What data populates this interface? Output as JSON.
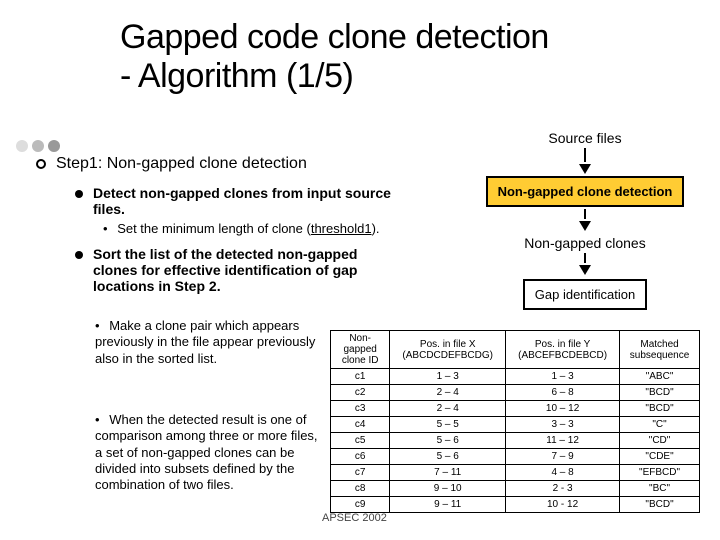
{
  "title_line1": "Gapped code clone detection",
  "title_line2": " - Algorithm (1/5)",
  "step1": "Step1: Non-gapped clone detection",
  "bullet1": "Detect non-gapped clones from input source files.",
  "bullet1_sub_prefix": "Set the minimum length of clone (",
  "bullet1_sub_underline": "threshold1",
  "bullet1_sub_suffix": ").",
  "bullet2": "Sort the list of the detected non-gapped clones for effective identification of gap locations in Step 2.",
  "note1": "Make a clone pair which appears previously in the file appear previously also in the sorted list.",
  "note2": "When the detected result is one of comparison among three or more files, a set of non-gapped clones can be divided into subsets defined by the combination of two files.",
  "flow": {
    "source_files": "Source files",
    "box1": "Non-gapped clone detection",
    "nongapped_clones": "Non-gapped clones",
    "box2": "Gap identification"
  },
  "table": {
    "headers": [
      "Non-gapped clone ID",
      "Pos. in file X (ABCDCDEFBCDG)",
      "Pos. in file Y (ABCEFBCDEBCD)",
      "Matched subsequence"
    ],
    "rows": [
      [
        "c1",
        "1 – 3",
        "1 – 3",
        "\"ABC\""
      ],
      [
        "c2",
        "2 – 4",
        "6 – 8",
        "\"BCD\""
      ],
      [
        "c3",
        "2 – 4",
        "10 – 12",
        "\"BCD\""
      ],
      [
        "c4",
        "5 – 5",
        "3 – 3",
        "\"C\""
      ],
      [
        "c5",
        "5 – 6",
        "11 – 12",
        "\"CD\""
      ],
      [
        "c6",
        "5 – 6",
        "7 – 9",
        "\"CDE\""
      ],
      [
        "c7",
        "7 – 11",
        "4 – 8",
        "\"EFBCD\""
      ],
      [
        "c8",
        "9 – 10",
        "2 - 3",
        "\"BC\""
      ],
      [
        "c9",
        "9 – 11",
        "10 - 12",
        "\"BCD\""
      ]
    ]
  },
  "footer": "APSEC 2002"
}
